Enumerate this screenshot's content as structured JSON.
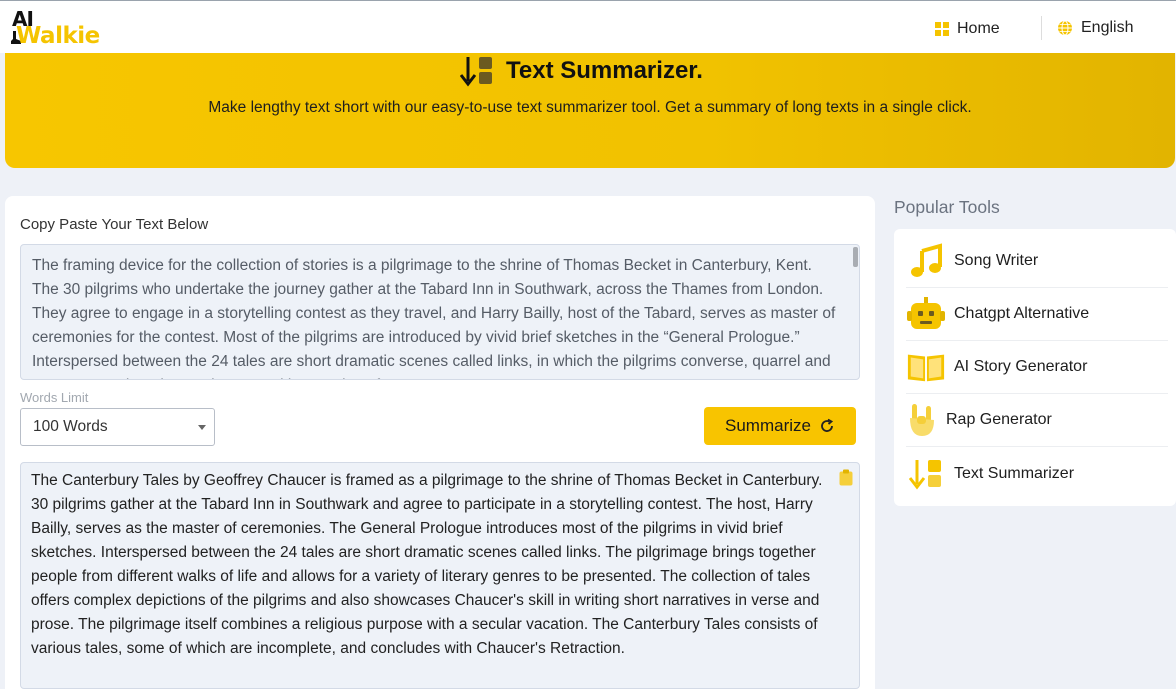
{
  "brand": {
    "logo_top": "AI",
    "logo_bottom": "Walkie"
  },
  "nav": {
    "home_label": "Home",
    "language_label": "English"
  },
  "hero": {
    "title": "Text Summarizer.",
    "subtitle": "Make lengthy text short with our easy-to-use text summarizer tool. Get a summary of long texts in a single click."
  },
  "input": {
    "label": "Copy Paste Your Text Below",
    "text": "The framing device for the collection of stories is a pilgrimage to the shrine of Thomas Becket in Canterbury, Kent. The 30 pilgrims who undertake the journey gather at the Tabard Inn in Southwark, across the Thames from London. They agree to engage in a storytelling contest as they travel, and Harry Bailly, host of the Tabard, serves as master of ceremonies for the contest. Most of the pilgrims are introduced by vivid brief sketches in the “General Prologue.” Interspersed between the 24 tales are short dramatic scenes called links, in which the pilgrims converse, quarrel and comment on the tales, and a general impression of"
  },
  "words_limit": {
    "label": "Words Limit",
    "selected": "100 Words"
  },
  "summarize_button": {
    "label": "Summarize"
  },
  "output": {
    "text": "The Canterbury Tales by Geoffrey Chaucer is framed as a pilgrimage to the shrine of Thomas Becket in Canterbury. 30 pilgrims gather at the Tabard Inn in Southwark and agree to participate in a storytelling contest. The host, Harry Bailly, serves as the master of ceremonies. The General Prologue introduces most of the pilgrims in vivid brief sketches. Interspersed between the 24 tales are short dramatic scenes called links. The pilgrimage brings together people from different walks of life and allows for a variety of literary genres to be presented. The collection of tales offers complex depictions of the pilgrims and also showcases Chaucer's skill in writing short narratives in verse and prose. The pilgrimage itself combines a religious purpose with a secular vacation. The Canterbury Tales consists of various tales, some of which are incomplete, and concludes with Chaucer's Retraction."
  },
  "popular_tools": {
    "title": "Popular Tools",
    "items": [
      {
        "label": "Song Writer",
        "icon": "music-note-icon"
      },
      {
        "label": "Chatgpt Alternative",
        "icon": "robot-icon"
      },
      {
        "label": "AI Story Generator",
        "icon": "open-book-icon"
      },
      {
        "label": "Rap Generator",
        "icon": "rock-hand-icon"
      },
      {
        "label": "Text Summarizer",
        "icon": "summarizer-icon"
      }
    ]
  },
  "colors": {
    "accent": "#f8c400",
    "hero_bg": "#f1c200",
    "panel_bg": "#eef2f8",
    "page_bg": "#eef1f7"
  }
}
